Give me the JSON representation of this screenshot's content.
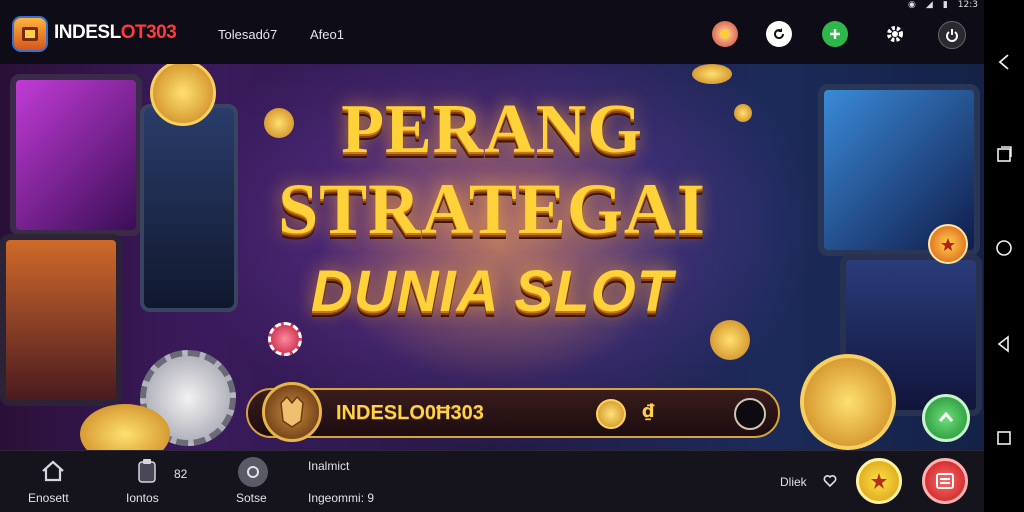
{
  "status": {
    "icons": [
      "signal-icon",
      "wifi-icon",
      "battery-icon"
    ],
    "time": "12:3"
  },
  "topbar": {
    "brand": "INDESLOT303",
    "brand_main": "INDESL",
    "brand_accent": "OT303",
    "nav": [
      "Tolesadó7",
      "Afeo1"
    ],
    "icons": [
      "promo-icon",
      "refresh-icon",
      "plus-icon",
      "gear-icon",
      "power-icon"
    ]
  },
  "banner": {
    "title_line1": "PERANG",
    "title_line2": "STRATEGAI",
    "title_line3": "DUNIA SLOT",
    "game_name": "INDESLO0Ħ303",
    "bar_value": "₫"
  },
  "bottombar": {
    "home_label": "Enosett",
    "history_label": "Iontos",
    "history_count": "82",
    "stats_label": "Sotse",
    "info_title": "Inalmict",
    "info_value": "Ingeommi: 9",
    "right_label": "Dliek"
  },
  "colors": {
    "accent_gold": "#ffd23a",
    "brand_red": "#ff3b3b",
    "fab_green": "#2fb84a",
    "fab_red": "#e23030",
    "fab_yellow": "#f3c21a"
  }
}
